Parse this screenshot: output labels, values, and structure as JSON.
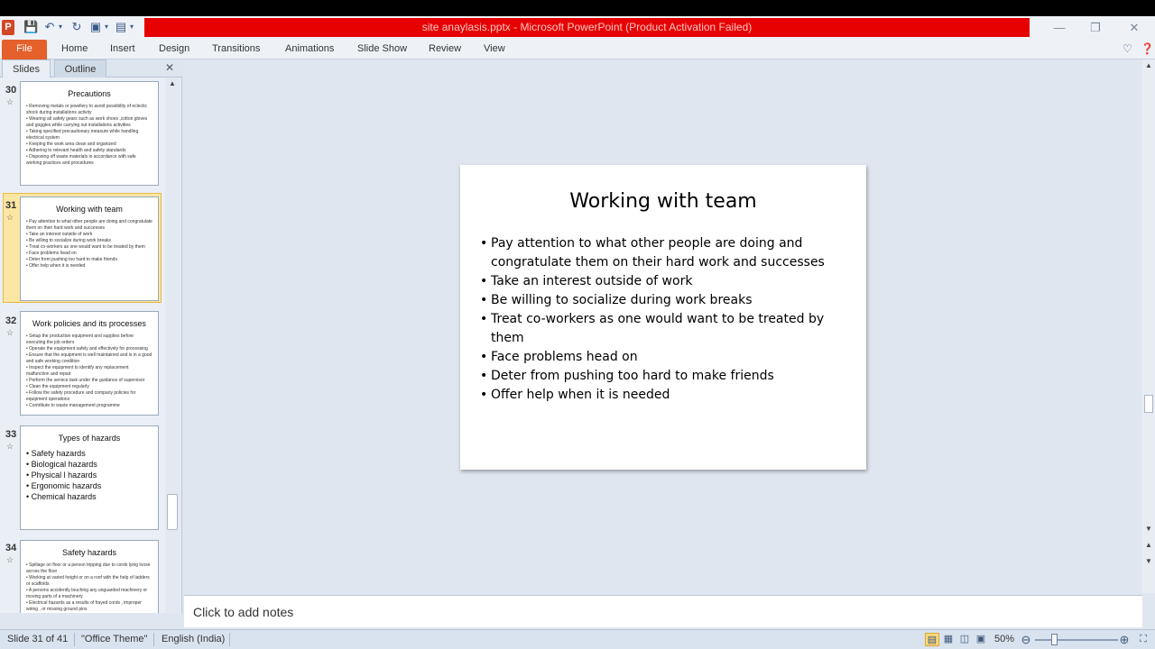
{
  "window": {
    "title": "site anaylasis.pptx  -  Microsoft PowerPoint (Product Activation Failed)",
    "logo_letter": "P",
    "minimize": "—",
    "restore": "❐",
    "close": "✕"
  },
  "ribbon": {
    "tabs": [
      "File",
      "Home",
      "Insert",
      "Design",
      "Transitions",
      "Animations",
      "Slide Show",
      "Review",
      "View"
    ]
  },
  "left_pane": {
    "tab_slides": "Slides",
    "tab_outline": "Outline",
    "close": "✕",
    "thumbnails": [
      {
        "number": "30",
        "title": "Precautions",
        "bullets": [
          "Removing metals  or jewellery  to avoid possibility  of eclectic shock during installations  activity",
          "Wearing  all safety gears such as work shoes ,cotton gloves and goggles  while  carrying out installations activities",
          "Taking specified  precautionary  measure while  handling electrical system",
          "Keeping  the work  area clean and organized",
          "Adhering  to relevant health  and safety standards",
          "Disposing  off waste materials in accordance with safe working  practices and procedures"
        ]
      },
      {
        "number": "31",
        "title": "Working with team",
        "bullets": [
          "Pay attention  to what other people  are doing and congratulate them on their hard work  and successes",
          "Take an interest  outside  of work",
          "Be willing  to socialize  during  work  breaks",
          "Treat co-workers as one would  want to be treated by them",
          "Face problems  head on",
          "Deter from pushing  too hard to make friends",
          "Offer help  when it is needed"
        ]
      },
      {
        "number": "32",
        "title": "Work policies and its processes",
        "bullets": [
          "Setup  the production equipment and supplies before executing the job  orders",
          "Operate  the equipment  safely  and effectively  for processing",
          "Ensure  that the equipment  is well maintained  and is in a good and safe working  condition",
          "Inspect  the equipment  to identify  any replacement  malfunction and repair",
          "Perform  the service  task under the guidance  of supervisor",
          "Clean  the equipment  regularly",
          "Follow  the safety  procedure  and company  policies  for equipment  operations",
          "Contribute  to waste management  programme"
        ]
      },
      {
        "number": "33",
        "title": "Types of hazards",
        "bullets": [
          "Safety hazards",
          "Biological hazards",
          "Physical l hazards",
          "Ergonomic hazards",
          "Chemical hazards"
        ]
      },
      {
        "number": "34",
        "title": "Safety hazards",
        "bullets": [
          "Spillage  on floor  or a person  tripping  due  to cords lying loose  across  the floor",
          "Working  at varied height  or on a roof with the help of ladders or scaffolds",
          "A persons accidently  touching  any unguarded machinery or moving parts of a machinery",
          "Electrical hazards  as a results  of frayed cords , improper wiring , or missing ground pins"
        ]
      }
    ]
  },
  "slide": {
    "title": "Working with team",
    "bullets": [
      "Pay attention to what other people are doing and congratulate them on their hard work  and successes",
      "Take an interest outside of work",
      "Be willing to socialize during work breaks",
      "Treat co-workers as one would want to be treated by them",
      "Face problems head on",
      "Deter from pushing too hard to make friends",
      "Offer help when it is needed"
    ]
  },
  "notes": {
    "placeholder": "Click to add notes"
  },
  "status": {
    "slide_position": "Slide 31 of 41",
    "theme": "\"Office Theme\"",
    "language": "English (India)",
    "zoom": "50%",
    "zoom_level_percent": 50
  },
  "colors": {
    "title_bar_alert": "#e60000",
    "file_tab": "#e5602a",
    "selected_thumb": "#fbe6a3"
  }
}
